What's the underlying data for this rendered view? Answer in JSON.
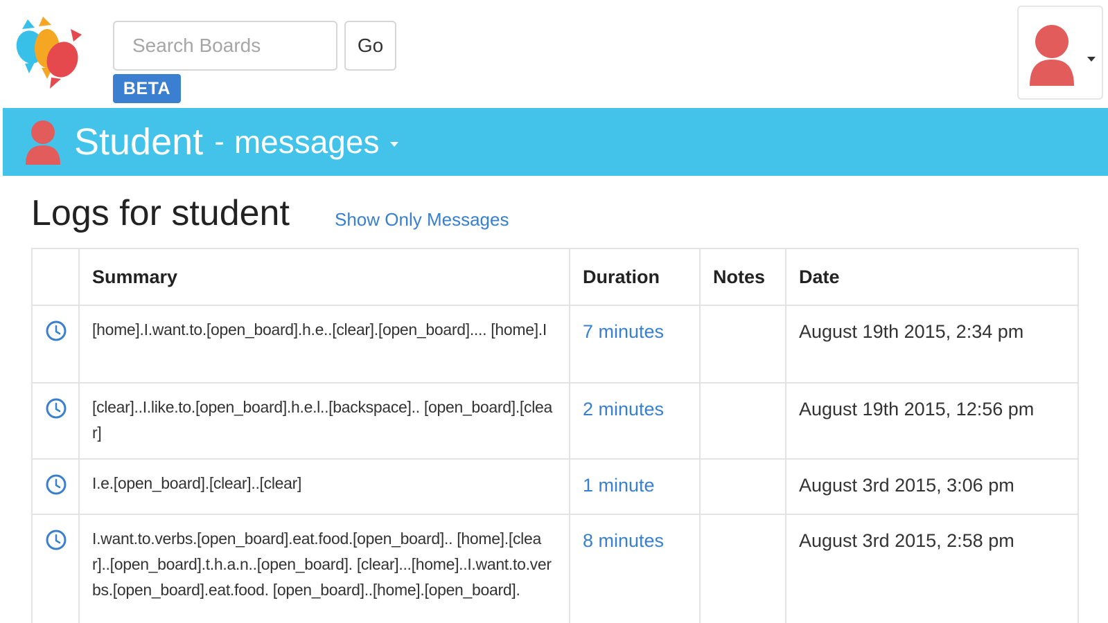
{
  "colors": {
    "accent_bar": "#43c3ea",
    "link": "#3880cf",
    "beta_badge": "#3a7fd0",
    "avatar": "#e25c5c"
  },
  "header": {
    "logo_icon": "candy-logo-icon",
    "search_placeholder": "Search Boards",
    "search_value": "",
    "go_label": "Go",
    "beta_label": "BETA",
    "user_menu_icon": "user-avatar-icon"
  },
  "title_bar": {
    "user_name": "Student",
    "separator": "-",
    "section": "messages"
  },
  "content": {
    "heading": "Logs for student",
    "filter_link": "Show Only Messages"
  },
  "table": {
    "columns": [
      "",
      "Summary",
      "Duration",
      "Notes",
      "Date"
    ],
    "rows": [
      {
        "icon": "clock-icon",
        "summary": "[home].I.want.to.[open_board].h.e..[clear].[open_board].... [home].I",
        "duration": "7 minutes",
        "notes": "",
        "date": "August 19th 2015, 2:34 pm"
      },
      {
        "icon": "clock-icon",
        "summary": "[clear]..I.like.to.[open_board].h.e.l..[backspace].. [open_board].[clear]",
        "duration": "2 minutes",
        "notes": "",
        "date": "August 19th 2015, 12:56 pm"
      },
      {
        "icon": "clock-icon",
        "summary": "I.e.[open_board].[clear]..[clear]",
        "duration": "1 minute",
        "notes": "",
        "date": "August 3rd 2015, 3:06 pm"
      },
      {
        "icon": "clock-icon",
        "summary": "I.want.to.verbs.[open_board].eat.food.[open_board].. [home].[clear]..[open_board].t.h.a.n..[open_board]. [clear]...[home]..I.want.to.verbs.[open_board].eat.food. [open_board]..[home].[open_board].",
        "duration": "8 minutes",
        "notes": "",
        "date": "August 3rd 2015, 2:58 pm"
      }
    ]
  }
}
